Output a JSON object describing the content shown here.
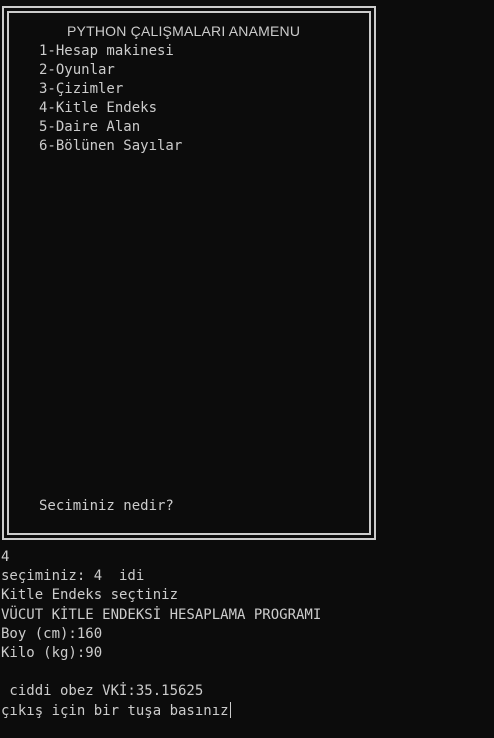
{
  "menu": {
    "title": "PYTHON ÇALIŞMALARI ANAMENU",
    "items": [
      "1-Hesap makinesi",
      "2-Oyunlar",
      "3-Çizimler",
      "4-Kitle Endeks",
      "5-Daire Alan",
      "6-Bölünen Sayılar"
    ],
    "prompt": "Seciminiz nedir?"
  },
  "console": {
    "lines": [
      "4",
      "seçiminiz: 4  idi",
      "Kitle Endeks seçtiniz",
      "VÜCUT KİTLE ENDEKSİ HESAPLAMA PROGRAMI",
      "Boy (cm):160",
      "Kilo (kg):90",
      "",
      " ciddi obez VKİ:35.15625",
      "çıkış için bir tuşa basınız"
    ]
  }
}
